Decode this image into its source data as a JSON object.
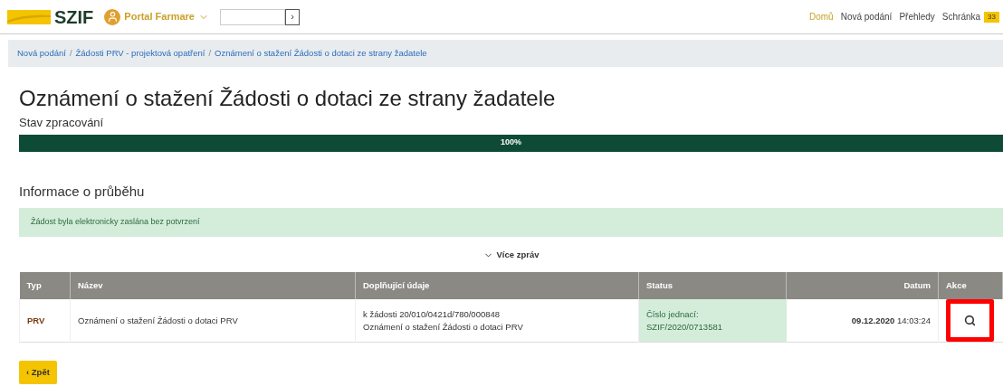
{
  "header": {
    "logo": "SZIF",
    "portal": "Portal Farmare",
    "search": {
      "button": "›"
    },
    "nav": [
      {
        "label": "Domů",
        "selected": true
      },
      {
        "label": "Nová podání",
        "selected": false
      },
      {
        "label": "Přehledy",
        "selected": false
      },
      {
        "label": "Schránka",
        "selected": false,
        "badge": "33"
      }
    ]
  },
  "breadcrumb_separator": "/",
  "breadcrumbs": [
    "Nová podání",
    "Žádosti PRV - projektová opatření",
    "Oznámení o stažení Žádosti o dotaci ze strany žadatele"
  ],
  "title": "Oznámení o stažení Žádosti o dotaci ze strany žadatele",
  "progress": {
    "label": "Stav zpracování",
    "level": 1,
    "reading": "100%"
  },
  "info": {
    "heading": "Informace o průběhu",
    "message": "Žádost byla elektronicky zaslána bez potvrzení",
    "more": "Více zpráv"
  },
  "table": {
    "columns": [
      "Typ",
      "Název",
      "Doplňující údaje",
      "Status",
      "Datum",
      "Akce"
    ],
    "rows": [
      {
        "type": "PRV",
        "name": "Oznámení o stažení Žádosti o dotaci PRV",
        "details": [
          "k žádosti 20/010/0421d/780/000848",
          "Oznámení o stažení Žádosti o dotaci PRV"
        ],
        "status": [
          "Číslo jednací:",
          "SZIF/2020/0713581"
        ],
        "date": "**09.12.2020** 14:03:24",
        "highlighted": true
      }
    ]
  },
  "back_button": "‹ Zpět"
}
